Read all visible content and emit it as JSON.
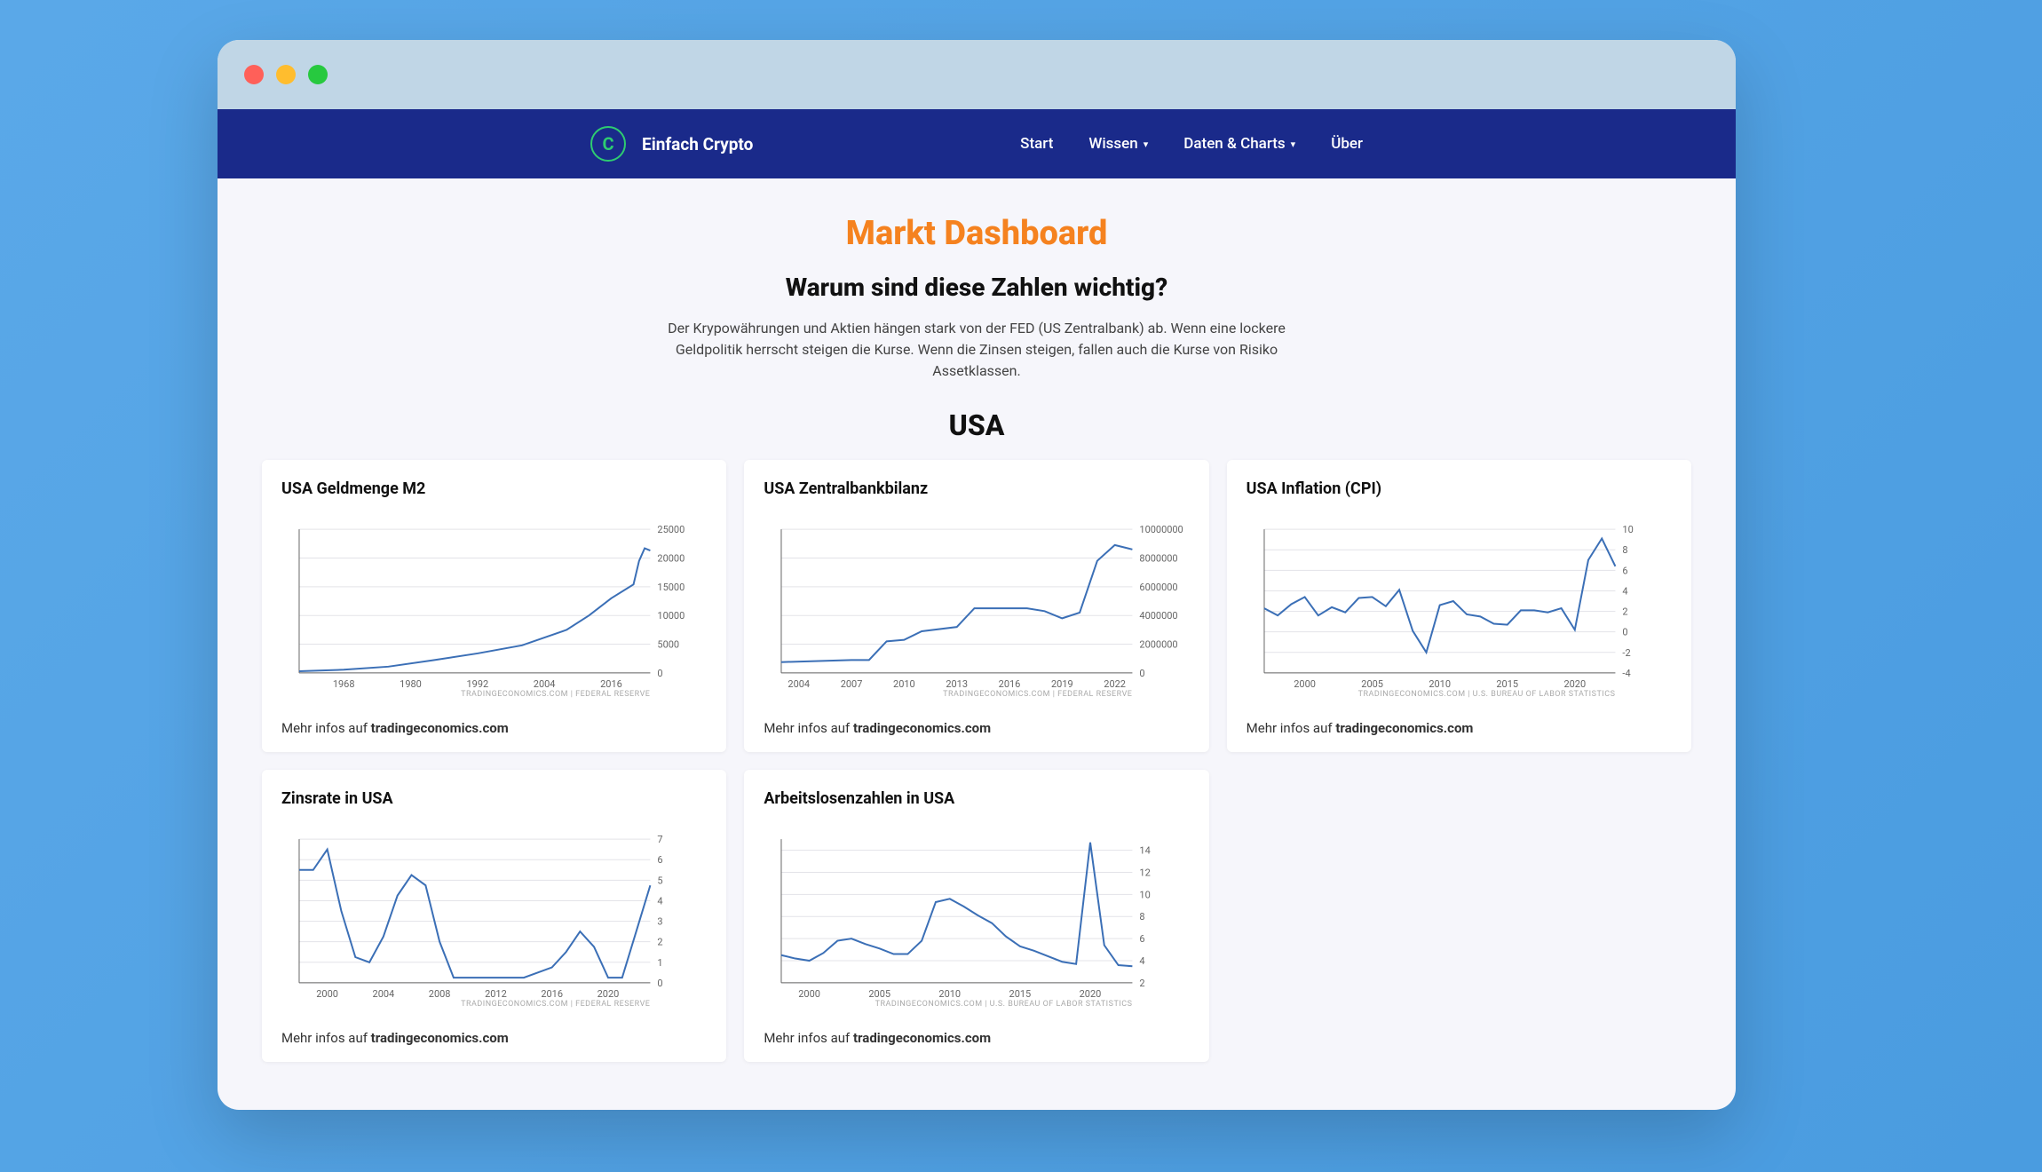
{
  "brand": "Einfach Crypto",
  "nav": {
    "start": "Start",
    "wissen": "Wissen",
    "daten": "Daten & Charts",
    "uber": "Über"
  },
  "page_title": "Markt Dashboard",
  "sub_title": "Warum sind diese Zahlen wichtig?",
  "intro_text": "Der Krypowährungen und Aktien hängen stark von der FED (US Zentralbank) ab. Wenn eine lockere Geldpolitik herrscht steigen die Kurse. Wenn die Zinsen steigen, fallen auch die Kurse von Risiko Assetklassen.",
  "section_title": "USA",
  "footer_prefix": "Mehr infos auf ",
  "footer_link": "tradingeconomics.com",
  "charts": [
    {
      "title": "USA Geldmenge M2",
      "source": "TRADINGECONOMICS.COM  |  FEDERAL RESERVE"
    },
    {
      "title": "USA Zentralbankbilanz",
      "source": "TRADINGECONOMICS.COM  |  FEDERAL RESERVE"
    },
    {
      "title": "USA Inflation (CPI)",
      "source": "TRADINGECONOMICS.COM  |  U.S. BUREAU OF LABOR STATISTICS"
    },
    {
      "title": "Zinsrate in USA",
      "source": "TRADINGECONOMICS.COM  |  FEDERAL RESERVE"
    },
    {
      "title": "Arbeitslosenzahlen in USA",
      "source": "TRADINGECONOMICS.COM  |  U.S. BUREAU OF LABOR STATISTICS"
    }
  ],
  "chart_data": [
    {
      "type": "line",
      "title": "USA Geldmenge M2",
      "xlabel": "",
      "ylabel": "",
      "x_ticks": [
        1968,
        1980,
        1992,
        2004,
        2016
      ],
      "y_ticks": [
        0,
        5000,
        10000,
        15000,
        20000,
        25000
      ],
      "ylim": [
        0,
        25000
      ],
      "xlim": [
        1960,
        2023
      ],
      "x": [
        1960,
        1968,
        1976,
        1984,
        1992,
        2000,
        2008,
        2012,
        2016,
        2020,
        2021,
        2022,
        2023
      ],
      "values": [
        300,
        550,
        1100,
        2200,
        3400,
        4800,
        7500,
        10000,
        13000,
        15400,
        19500,
        21700,
        21300
      ]
    },
    {
      "type": "line",
      "title": "USA Zentralbankbilanz",
      "xlabel": "",
      "ylabel": "",
      "x_ticks": [
        2004,
        2007,
        2010,
        2013,
        2016,
        2019,
        2022
      ],
      "y_ticks": [
        0,
        2000000,
        4000000,
        6000000,
        8000000,
        10000000
      ],
      "ylim": [
        0,
        10000000
      ],
      "xlim": [
        2003,
        2023
      ],
      "x": [
        2003,
        2007,
        2008,
        2009,
        2010,
        2011,
        2013,
        2014,
        2015,
        2017,
        2018,
        2019,
        2020,
        2021,
        2022,
        2023
      ],
      "values": [
        750000,
        900000,
        900000,
        2200000,
        2300000,
        2900000,
        3200000,
        4500000,
        4500000,
        4500000,
        4300000,
        3800000,
        4200000,
        7800000,
        8900000,
        8600000
      ]
    },
    {
      "type": "line",
      "title": "USA Inflation (CPI)",
      "xlabel": "",
      "ylabel": "",
      "x_ticks": [
        2000,
        2005,
        2010,
        2015,
        2020
      ],
      "y_ticks": [
        -4,
        -2,
        0,
        2,
        4,
        6,
        8,
        10
      ],
      "ylim": [
        -4,
        10
      ],
      "xlim": [
        1997,
        2023
      ],
      "x": [
        1997,
        1998,
        1999,
        2000,
        2001,
        2002,
        2003,
        2004,
        2005,
        2006,
        2007,
        2008,
        2009,
        2010,
        2011,
        2012,
        2013,
        2014,
        2015,
        2016,
        2017,
        2018,
        2019,
        2020,
        2021,
        2022,
        2023
      ],
      "values": [
        2.3,
        1.6,
        2.7,
        3.4,
        1.6,
        2.4,
        1.9,
        3.3,
        3.4,
        2.5,
        4.1,
        0.1,
        -2.0,
        2.6,
        3.0,
        1.7,
        1.5,
        0.8,
        0.7,
        2.1,
        2.1,
        1.9,
        2.3,
        0.2,
        7.0,
        9.1,
        6.4
      ]
    },
    {
      "type": "line",
      "title": "Zinsrate in USA",
      "xlabel": "",
      "ylabel": "",
      "x_ticks": [
        2000,
        2004,
        2008,
        2012,
        2016,
        2020
      ],
      "y_ticks": [
        0,
        1,
        2,
        3,
        4,
        5,
        6,
        7
      ],
      "ylim": [
        0,
        7
      ],
      "xlim": [
        1998,
        2023
      ],
      "x": [
        1998,
        1999,
        2000,
        2001,
        2002,
        2003,
        2004,
        2005,
        2006,
        2007,
        2008,
        2009,
        2010,
        2012,
        2014,
        2015,
        2016,
        2017,
        2018,
        2019,
        2020,
        2021,
        2022,
        2023
      ],
      "values": [
        5.5,
        5.5,
        6.5,
        3.5,
        1.25,
        1.0,
        2.25,
        4.25,
        5.25,
        4.75,
        2.0,
        0.25,
        0.25,
        0.25,
        0.25,
        0.5,
        0.75,
        1.5,
        2.5,
        1.75,
        0.25,
        0.25,
        2.5,
        4.75
      ]
    },
    {
      "type": "line",
      "title": "Arbeitslosenzahlen in USA",
      "xlabel": "",
      "ylabel": "",
      "x_ticks": [
        2000,
        2005,
        2010,
        2015,
        2020
      ],
      "y_ticks": [
        2,
        4,
        6,
        8,
        10,
        12,
        14
      ],
      "ylim": [
        2,
        15
      ],
      "xlim": [
        1998,
        2023
      ],
      "x": [
        1998,
        1999,
        2000,
        2001,
        2002,
        2003,
        2004,
        2005,
        2006,
        2007,
        2008,
        2009,
        2010,
        2011,
        2012,
        2013,
        2014,
        2015,
        2016,
        2017,
        2018,
        2019,
        2020,
        2021,
        2022,
        2023
      ],
      "values": [
        4.5,
        4.2,
        4.0,
        4.7,
        5.8,
        6.0,
        5.5,
        5.1,
        4.6,
        4.6,
        5.8,
        9.3,
        9.6,
        8.9,
        8.1,
        7.4,
        6.2,
        5.3,
        4.9,
        4.4,
        3.9,
        3.7,
        14.7,
        5.4,
        3.6,
        3.5
      ]
    }
  ]
}
